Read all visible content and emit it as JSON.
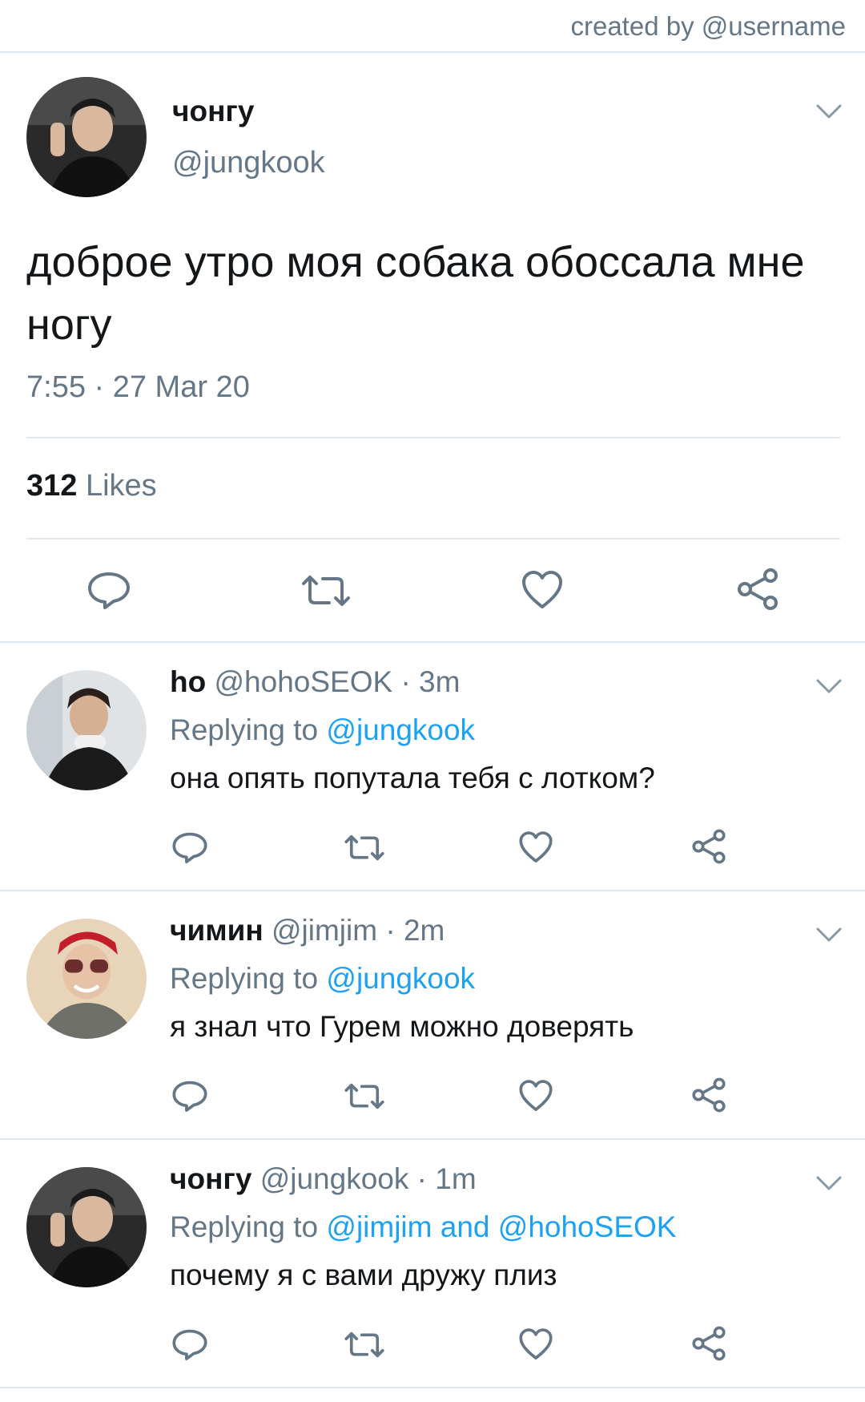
{
  "watermark": "created by @username",
  "tweet": {
    "name": "чонгу",
    "handle": "@jungkook",
    "text": "доброе утро моя собака обоссала мне ногу",
    "timestamp": "7:55 · 27 Mar 20",
    "likes_count": "312",
    "likes_label": "Likes",
    "actions": [
      "reply-icon",
      "retweet-icon",
      "like-icon",
      "share-icon"
    ]
  },
  "replies": [
    {
      "name": "ho",
      "handle": "@hohoSEOK",
      "time": "· 3m",
      "replying_label": "Replying to",
      "replying_to": "@jungkook",
      "text": "она опять попутала тебя с лотком?"
    },
    {
      "name": "чимин",
      "handle": "@jimjim",
      "time": "· 2m",
      "replying_label": "Replying to",
      "replying_to": "@jungkook",
      "text": "я знал что Гурем можно доверять"
    },
    {
      "name": "чонгу",
      "handle": "@jungkook",
      "time": "· 1m",
      "replying_label": "Replying to",
      "replying_to": "@jimjim and @hohoSEOK",
      "text": "почему я с вами дружу плиз"
    }
  ],
  "colors": {
    "text": "#14171a",
    "secondary": "#657786",
    "mention": "#1da1f2",
    "icon": "#657786",
    "divider": "#e1e8ed"
  }
}
